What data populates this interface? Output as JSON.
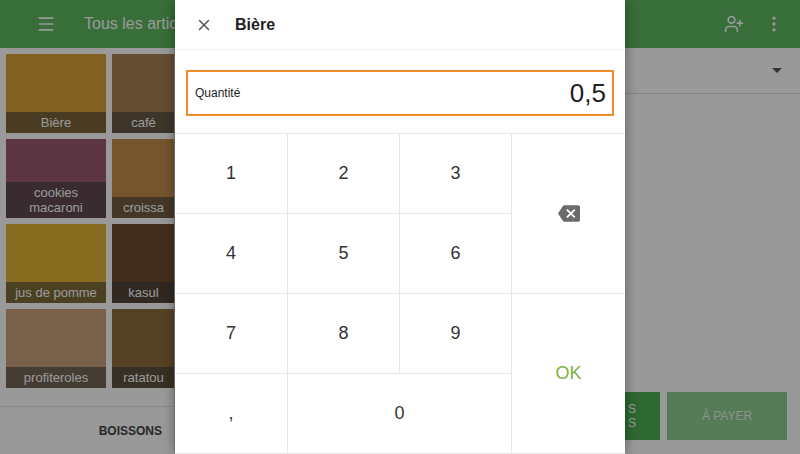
{
  "app_bar": {
    "title": "Tous les articl"
  },
  "items": [
    {
      "name": "Bière",
      "color": "#d9a43a"
    },
    {
      "name": "café",
      "color": "#a98058"
    },
    {
      "name": "cookies macaroni",
      "color": "#9a5a6e"
    },
    {
      "name": "croissa",
      "color": "#c58e4e"
    },
    {
      "name": "jus de pomme",
      "color": "#e2b536"
    },
    {
      "name": "kasul",
      "color": "#6e4e30"
    },
    {
      "name": "profiteroles",
      "color": "#c9a17e"
    },
    {
      "name": "ratatou",
      "color": "#8e6e3e"
    }
  ],
  "categories": [
    {
      "label": "BOISSONS",
      "selected": false
    }
  ],
  "order_actions": [
    {
      "kind": "partial",
      "lines": [
        "S",
        "S"
      ]
    },
    {
      "kind": "pay",
      "lines": [
        "À PAYER"
      ]
    }
  ],
  "dialog": {
    "title": "Bière",
    "field": {
      "label": "Quantité",
      "value": "0,5",
      "focused": true
    },
    "keys": [
      {
        "kind": "digit",
        "label": "1"
      },
      {
        "kind": "digit",
        "label": "2"
      },
      {
        "kind": "digit",
        "label": "3"
      },
      {
        "kind": "backspace",
        "label": ""
      },
      {
        "kind": "digit",
        "label": "4"
      },
      {
        "kind": "digit",
        "label": "5"
      },
      {
        "kind": "digit",
        "label": "6"
      },
      {
        "kind": "digit",
        "label": "7"
      },
      {
        "kind": "digit",
        "label": "8"
      },
      {
        "kind": "digit",
        "label": "9"
      },
      {
        "kind": "ok",
        "label": "OK"
      },
      {
        "kind": "digit",
        "label": ","
      },
      {
        "kind": "wide",
        "label": "0"
      }
    ]
  }
}
